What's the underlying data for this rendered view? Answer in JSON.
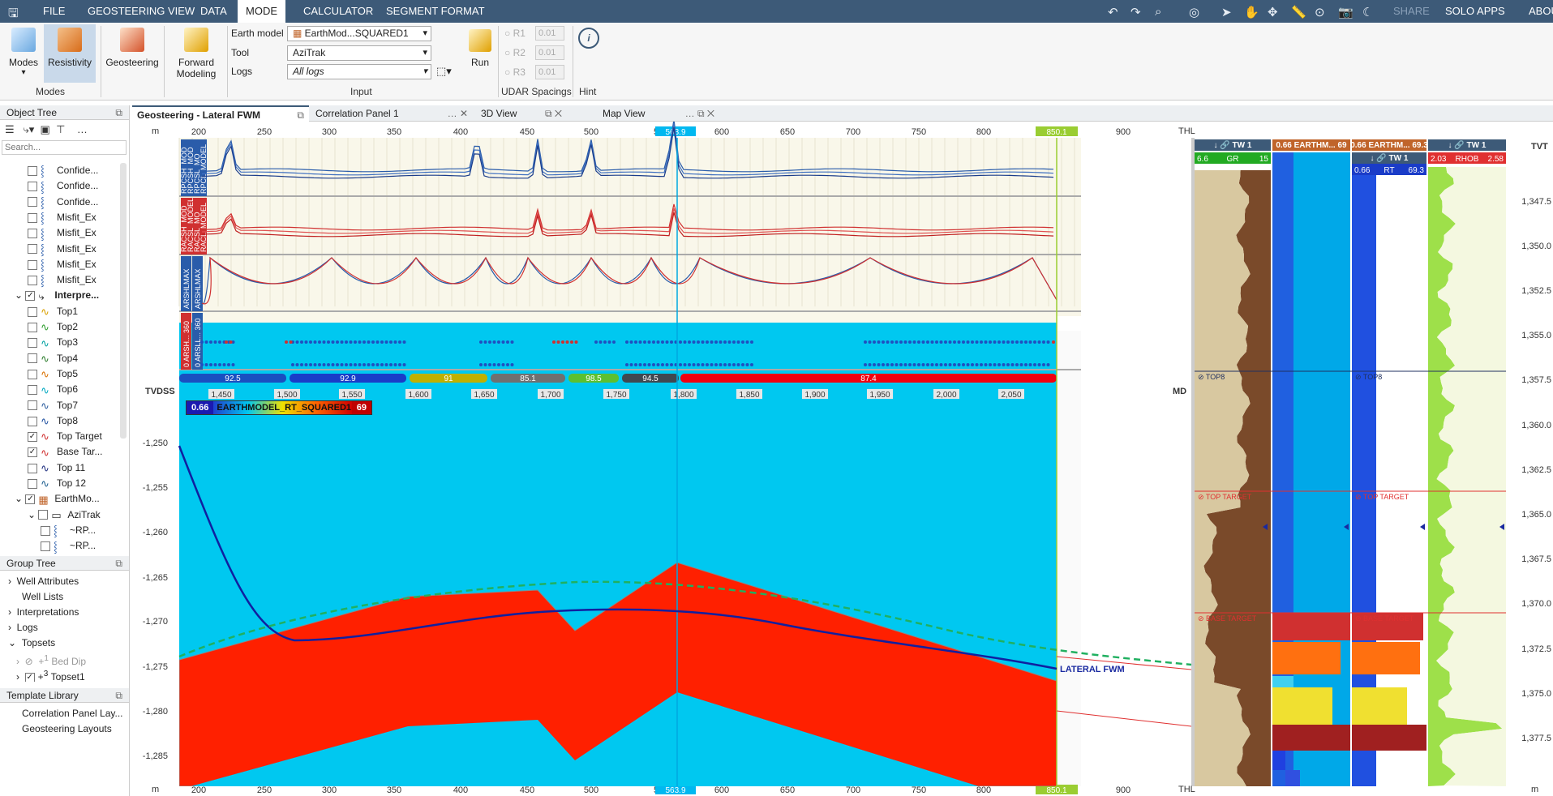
{
  "menu": {
    "items": [
      "FILE",
      "GEOSTEERING VIEW",
      "DATA",
      "MODE",
      "CALCULATOR",
      "SEGMENT FORMAT"
    ],
    "active": "MODE",
    "right": [
      "SHARE",
      "SOLO APPS",
      "ABOUT"
    ]
  },
  "ribbon": {
    "modes_label": "Modes",
    "resistivity_label": "Resistivity",
    "geosteering_label": "Geosteering",
    "forward_modeling_label": "Forward Modeling",
    "modes_group": "Modes",
    "earth_model_label": "Earth model",
    "earth_model_value": "EarthMod...SQUARED1",
    "tool_label": "Tool",
    "tool_value": "AziTrak",
    "logs_label": "Logs",
    "logs_value": "All logs",
    "run_label": "Run",
    "input_group": "Input",
    "r1": "R1",
    "r2": "R2",
    "r3": "R3",
    "spacing_value": "0.01",
    "udar_group": "UDAR Spacings",
    "hint_group": "Hint"
  },
  "object_tree": {
    "title": "Object Tree",
    "search_placeholder": "Search...",
    "items": [
      {
        "label": "Confide...",
        "checked": false,
        "indent": 3
      },
      {
        "label": "Confide...",
        "checked": false,
        "indent": 3
      },
      {
        "label": "Confide...",
        "checked": false,
        "indent": 3
      },
      {
        "label": "Misfit_Ex",
        "checked": false,
        "indent": 3
      },
      {
        "label": "Misfit_Ex",
        "checked": false,
        "indent": 3
      },
      {
        "label": "Misfit_Ex",
        "checked": false,
        "indent": 3
      },
      {
        "label": "Misfit_Ex",
        "checked": false,
        "indent": 3
      },
      {
        "label": "Misfit_Ex",
        "checked": false,
        "indent": 3
      },
      {
        "label": "Interpre...",
        "checked": true,
        "indent": 2
      },
      {
        "label": "Top1",
        "checked": false,
        "indent": 3
      },
      {
        "label": "Top2",
        "checked": false,
        "indent": 3
      },
      {
        "label": "Top3",
        "checked": false,
        "indent": 3
      },
      {
        "label": "Top4",
        "checked": false,
        "indent": 3
      },
      {
        "label": "Top5",
        "checked": false,
        "indent": 3
      },
      {
        "label": "Top6",
        "checked": false,
        "indent": 3
      },
      {
        "label": "Top7",
        "checked": false,
        "indent": 3
      },
      {
        "label": "Top8",
        "checked": false,
        "indent": 3
      },
      {
        "label": "Top Target",
        "checked": true,
        "indent": 3
      },
      {
        "label": "Base Tar...",
        "checked": true,
        "indent": 3
      },
      {
        "label": "Top 11",
        "checked": false,
        "indent": 3
      },
      {
        "label": "Top 12",
        "checked": false,
        "indent": 3
      },
      {
        "label": "EarthMo...",
        "checked": true,
        "indent": 2
      },
      {
        "label": "AziTrak",
        "checked": false,
        "indent": 3
      },
      {
        "label": "~RP...",
        "checked": false,
        "indent": 4
      },
      {
        "label": "~RP...",
        "checked": false,
        "indent": 4
      }
    ]
  },
  "group_tree": {
    "title": "Group Tree",
    "items": [
      "Well Attributes",
      "Well Lists",
      "Interpretations",
      "Logs",
      "Topsets",
      "Bed Dip",
      "Topset1"
    ],
    "bed_dip_sup": "1",
    "topset_sup": "3"
  },
  "template_library": {
    "title": "Template Library",
    "items": [
      "Correlation Panel Lay...",
      "Geosteering Layouts"
    ]
  },
  "tabs": [
    "Geosteering - Lateral FWM",
    "Correlation Panel 1",
    "3D View",
    "Map View"
  ],
  "geo": {
    "unit_m": "m",
    "thl": "THL",
    "md_ticks": [
      "200",
      "250",
      "300",
      "350",
      "400",
      "450",
      "500",
      "5",
      "600",
      "650",
      "700",
      "750",
      "800",
      "850.1",
      "900"
    ],
    "cursor_label": "563.9",
    "cursor_label_bottom": "563.9",
    "track_labels": [
      [
        "RPCSH_MOD",
        "RPCSH_MOD",
        "RPCSL_MO",
        "RPCL_MODEL"
      ],
      [
        "RACSH_MOD",
        "RACSL_MODEL",
        "RACSL_MO",
        "RACL_MODEL"
      ],
      [
        "ARSHLMAX",
        "ARSHLMAX"
      ],
      [
        "0 ARSH... 360",
        "0 ARSLL... 360"
      ]
    ],
    "segments": [
      "92.5",
      "92.9",
      "91",
      "85.1",
      "98.5",
      "94.5",
      "87.4"
    ],
    "tvdss_label": "TVDSS",
    "md_label": "MD",
    "vs_ticks": [
      "1,450",
      "1,500",
      "1,550",
      "1,600",
      "1,650",
      "1,700",
      "1,750",
      "1,800",
      "1,850",
      "1,900",
      "1,950",
      "2,000",
      "2,050"
    ],
    "legend": {
      "min": "0.66",
      "name": "EARTHMODEL_RT_SQUARED1",
      "max": "69"
    },
    "tvd_ticks": [
      "-1,250",
      "-1,255",
      "-1,260",
      "-1,265",
      "-1,270",
      "-1,275",
      "-1,280",
      "-1,285"
    ],
    "lateral_label": "LATERAL FWM"
  },
  "logs": {
    "tracks": [
      {
        "header": "TW 1",
        "curve": "GR",
        "min": "6.6",
        "max": "15",
        "color": "#1a9e1a"
      },
      {
        "header": "EARTHM...",
        "curve": "",
        "min": "0.66",
        "max": "69",
        "color": "#c0642a"
      },
      {
        "header": "EARTHM...",
        "curve": "RT",
        "min": "0.66",
        "max": "69.3",
        "color": "#1a3cc8",
        "sub": "TW 1"
      },
      {
        "header": "TW 1",
        "curve": "RHOB",
        "min": "2.03",
        "max": "2.58",
        "color": "#d22"
      }
    ],
    "tvt": "TVT",
    "depth_ticks": [
      "1,347.5",
      "1,350.0",
      "1,352.5",
      "1,355.0",
      "1,357.5",
      "1,360.0",
      "1,362.5",
      "1,365.0",
      "1,367.5",
      "1,370.0",
      "1,372.5",
      "1,375.0",
      "1,377.5"
    ],
    "unit_m": "m",
    "tops": [
      "TOP8",
      "TOP TARGET",
      "BASE TARGET",
      "TOP8",
      "TOP TARGET",
      "BASE TARGET"
    ]
  }
}
